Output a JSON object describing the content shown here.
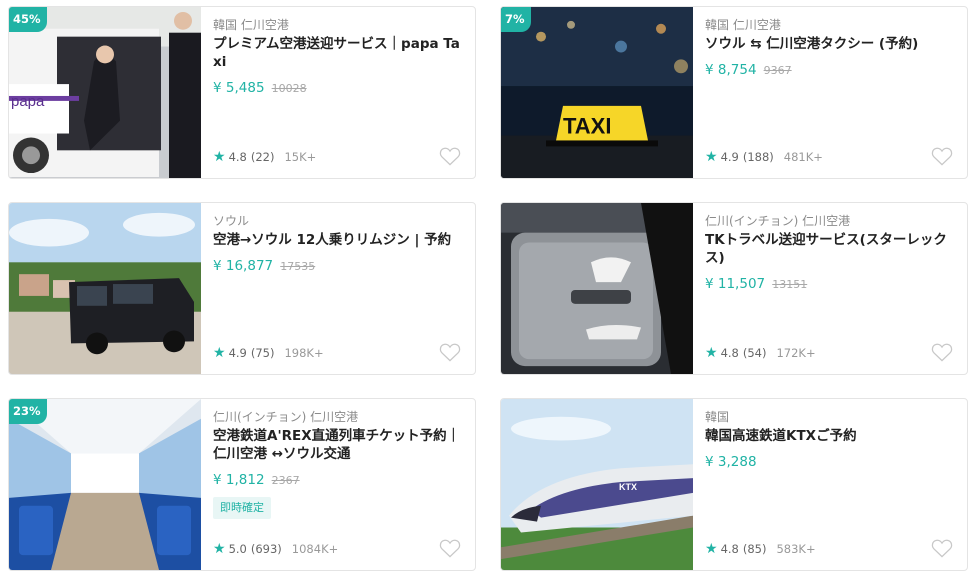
{
  "products": [
    {
      "location": "韓国 仁川空港",
      "title": "プレミアム空港送迎サービス｜papa Taxi",
      "price": "¥ 5,485",
      "original_price": "10028",
      "discount": "45%",
      "rating": "4.8",
      "review_count": "(22)",
      "booked": "15K+",
      "image": "premium-van-photo",
      "image_text": "papa"
    },
    {
      "location": "韓国 仁川空港",
      "title": "ソウル ⇆ 仁川空港タクシー (予約)",
      "price": "¥ 8,754",
      "original_price": "9367",
      "discount": "7%",
      "rating": "4.9",
      "review_count": "(188)",
      "booked": "481K+",
      "image": "taxi-sign-photo",
      "image_text": "TAXI"
    },
    {
      "location": "ソウル",
      "title": "空港→ソウル 12人乗りリムジン | 予約",
      "price": "¥ 16,877",
      "original_price": "17535",
      "rating": "4.9",
      "review_count": "(75)",
      "booked": "198K+",
      "image": "black-van-photo"
    },
    {
      "location": "仁川(インチョン) 仁川空港",
      "title": "TKトラベル送迎サービス(スターレックス)",
      "price": "¥ 11,507",
      "original_price": "13151",
      "rating": "4.8",
      "review_count": "(54)",
      "booked": "172K+",
      "image": "suitcase-photo"
    },
    {
      "location": "仁川(インチョン) 仁川空港",
      "title": "空港鉄道A'REX直通列車チケット予約｜仁川空港 ↔ソウル交通",
      "price": "¥ 1,812",
      "original_price": "2367",
      "discount": "23%",
      "badge": "即時確定",
      "rating": "5.0",
      "review_count": "(693)",
      "booked": "1084K+",
      "image": "train-interior-photo"
    },
    {
      "location": "韓国",
      "title": "韓国高速鉄道KTXご予約",
      "price": "¥ 3,288",
      "rating": "4.8",
      "review_count": "(85)",
      "booked": "583K+",
      "image": "ktx-train-photo",
      "image_text": "KTX"
    }
  ],
  "colors": {
    "accent": "#21b3a5",
    "border": "#e4e4e4",
    "muted": "#8b8b8b"
  },
  "icons": {
    "rating": "star-icon",
    "wishlist": "heart-icon"
  }
}
